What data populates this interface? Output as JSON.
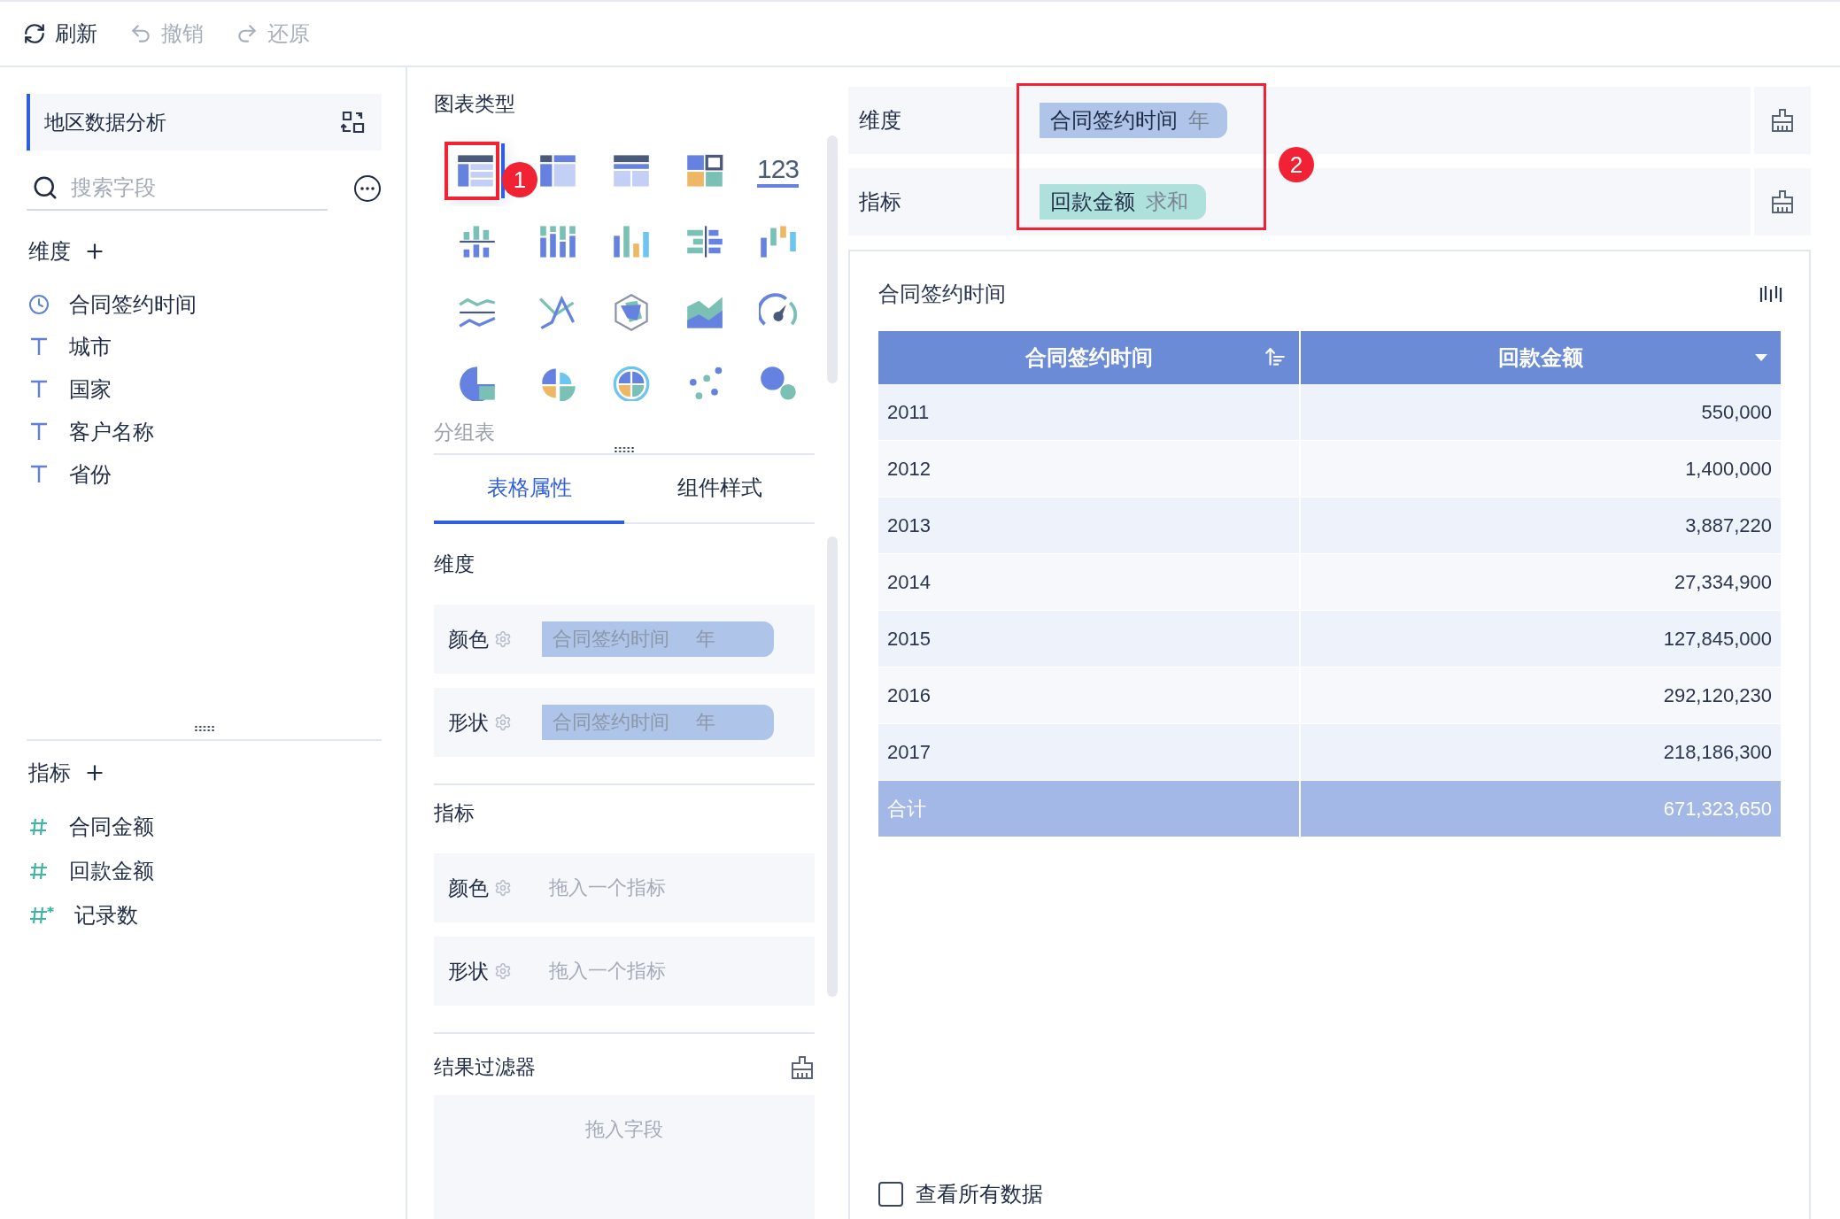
{
  "toolbar": [
    {
      "kind": "refresh",
      "label": "刷新",
      "disabled": false
    },
    {
      "kind": "undo",
      "label": "撤销",
      "disabled": true
    },
    {
      "kind": "redo",
      "label": "还原",
      "disabled": true
    }
  ],
  "sidebar": {
    "dataset": "地区数据分析",
    "search": {
      "placeholder": "搜索字段"
    },
    "dimensions": {
      "title": "维度",
      "fields": [
        {
          "kind": "date",
          "label": "合同签约时间"
        },
        {
          "kind": "text",
          "label": "城市"
        },
        {
          "kind": "text",
          "label": "国家"
        },
        {
          "kind": "text",
          "label": "客户名称"
        },
        {
          "kind": "text",
          "label": "省份"
        }
      ]
    },
    "measures": {
      "title": "指标",
      "fields": [
        {
          "kind": "number",
          "label": "合同金额"
        },
        {
          "kind": "number",
          "label": "回款金额"
        },
        {
          "kind": "computed",
          "label": "记录数"
        }
      ]
    }
  },
  "chart_panel": {
    "title": "图表类型",
    "types": [
      {
        "kind": "group-table",
        "selected": true
      },
      {
        "kind": "cross-table",
        "selected": false
      },
      {
        "kind": "detail-table",
        "selected": false
      },
      {
        "kind": "blocks",
        "selected": false
      },
      {
        "kind": "number",
        "label": "123",
        "selected": false
      },
      {
        "kind": "multi-column",
        "selected": false
      },
      {
        "kind": "stacked-column",
        "selected": false
      },
      {
        "kind": "column",
        "selected": false
      },
      {
        "kind": "compare-bar",
        "selected": false
      },
      {
        "kind": "range-column",
        "selected": false
      },
      {
        "kind": "multi-line",
        "selected": false
      },
      {
        "kind": "line",
        "selected": false
      },
      {
        "kind": "radar",
        "selected": false
      },
      {
        "kind": "area",
        "selected": false
      },
      {
        "kind": "gauge",
        "selected": false
      },
      {
        "kind": "pie",
        "selected": false
      },
      {
        "kind": "rose",
        "selected": false
      },
      {
        "kind": "polar",
        "selected": false
      },
      {
        "kind": "scatter",
        "selected": false
      },
      {
        "kind": "bubble",
        "selected": false
      }
    ],
    "tooltip": "分组表",
    "tabs": [
      {
        "label": "表格属性",
        "selected": true
      },
      {
        "label": "组件样式",
        "selected": false
      }
    ],
    "sections": [
      {
        "title": "维度",
        "rows": [
          {
            "label": "颜色",
            "field": "合同签约时间",
            "unit": "年"
          },
          {
            "label": "形状",
            "field": "合同签约时间",
            "unit": "年"
          }
        ]
      },
      {
        "title": "指标",
        "rows": [
          {
            "label": "颜色",
            "placeholder": "拖入一个指标"
          },
          {
            "label": "形状",
            "placeholder": "拖入一个指标"
          }
        ]
      }
    ],
    "filter": {
      "title": "结果过滤器",
      "placeholder": "拖入字段"
    }
  },
  "shelves": [
    {
      "kind": "dimension",
      "label": "维度",
      "pill": {
        "name": "合同签约时间",
        "agg": "年"
      }
    },
    {
      "kind": "measure",
      "label": "指标",
      "pill": {
        "name": "回款金额",
        "agg": "求和"
      }
    }
  ],
  "annotations": [
    {
      "label": "1"
    },
    {
      "label": "2"
    }
  ],
  "table_card": {
    "title": "合同签约时间",
    "columns": [
      {
        "label": "合同签约时间",
        "kind": "sort"
      },
      {
        "label": "回款金额",
        "kind": "menu"
      }
    ],
    "rows": [
      [
        "2011",
        "550,000"
      ],
      [
        "2012",
        "1,400,000"
      ],
      [
        "2013",
        "3,887,220"
      ],
      [
        "2014",
        "27,334,900"
      ],
      [
        "2015",
        "127,845,000"
      ],
      [
        "2016",
        "292,120,230"
      ],
      [
        "2017",
        "218,186,300"
      ]
    ],
    "total": [
      "合计",
      "671,323,650"
    ],
    "show_all": {
      "label": "查看所有数据",
      "checked": false
    }
  }
}
